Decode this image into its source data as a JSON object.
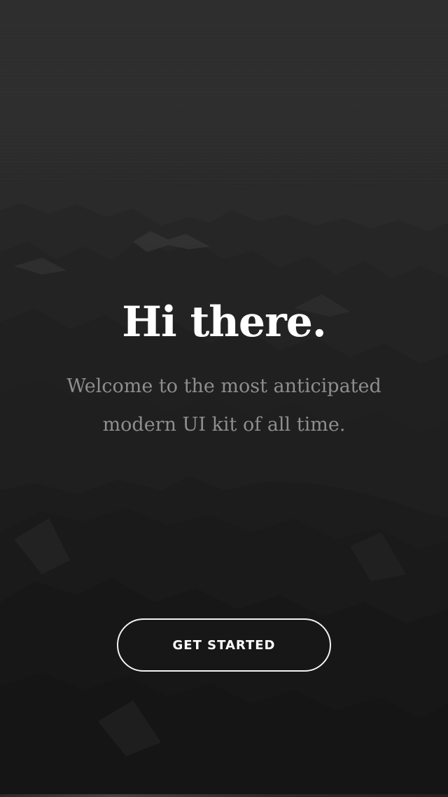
{
  "screen": {
    "title": "Hi there.",
    "subtitle_line1": "Welcome to the most anticipated",
    "subtitle_line2": "modern UI kit of all time.",
    "cta_label": "GET STARTED"
  },
  "background": {
    "image": "mountain-range-photo",
    "tone": "dark grayscale"
  },
  "colors": {
    "background": "#1f1f1f",
    "title": "#ffffff",
    "subtitle": "#8e8e8e",
    "button_border": "#f2f2f2",
    "button_text": "#ffffff"
  }
}
